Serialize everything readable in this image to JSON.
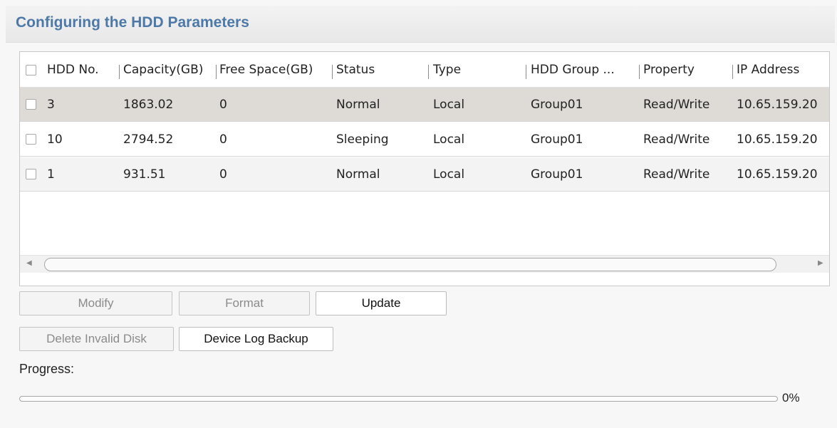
{
  "header": {
    "title": "Configuring the HDD Parameters"
  },
  "table": {
    "columns": [
      "HDD No.",
      "Capacity(GB)",
      "Free Space(GB)",
      "Status",
      "Type",
      "HDD Group ...",
      "Property",
      "IP Address"
    ],
    "rows": [
      {
        "hdd_no": "3",
        "capacity": "1863.02",
        "free_space": "0",
        "status": "Normal",
        "type": "Local",
        "group": "Group01",
        "property": "Read/Write",
        "ip": "10.65.159.20"
      },
      {
        "hdd_no": "10",
        "capacity": "2794.52",
        "free_space": "0",
        "status": "Sleeping",
        "type": "Local",
        "group": "Group01",
        "property": "Read/Write",
        "ip": "10.65.159.20"
      },
      {
        "hdd_no": "1",
        "capacity": "931.51",
        "free_space": "0",
        "status": "Normal",
        "type": "Local",
        "group": "Group01",
        "property": "Read/Write",
        "ip": "10.65.159.20"
      }
    ],
    "selected_row": 0
  },
  "buttons": {
    "modify": "Modify",
    "format": "Format",
    "update": "Update",
    "delete_invalid_disk": "Delete Invalid Disk",
    "device_log_backup": "Device Log Backup"
  },
  "progress": {
    "label": "Progress:",
    "value_text": "0%",
    "value": 0
  },
  "colors": {
    "title": "#4d79a8",
    "selected_row": "#dedbd7"
  },
  "icons": {
    "scroll_left": "scroll-left-arrow-icon",
    "scroll_right": "scroll-right-arrow-icon",
    "checkbox": "checkbox-icon"
  }
}
